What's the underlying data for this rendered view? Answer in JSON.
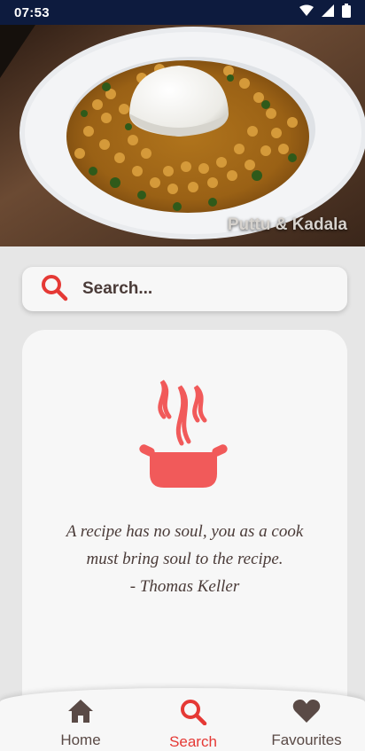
{
  "status_bar": {
    "time": "07:53",
    "icons": [
      "wifi-icon",
      "cellular-signal-icon",
      "battery-icon"
    ]
  },
  "hero": {
    "caption": "Puttu & Kadala"
  },
  "search": {
    "placeholder": "Search...",
    "value": "",
    "icon": "search-icon"
  },
  "quote": {
    "icon": "cooking-pot-icon",
    "line1": "A recipe has no soul, you as a cook",
    "line2": "must bring soul to the recipe.",
    "author": "- Thomas Keller"
  },
  "bottom_nav": {
    "items": [
      {
        "label": "Home",
        "icon": "home-icon",
        "active": false
      },
      {
        "label": "Search",
        "icon": "search-icon",
        "active": true
      },
      {
        "label": "Favourites",
        "icon": "heart-icon",
        "active": false
      }
    ]
  },
  "colors": {
    "accent": "#e53935",
    "text": "#4a3b38",
    "status_bar": "#0d1b3e",
    "background": "#e6e6e6",
    "card": "#f7f7f7"
  }
}
